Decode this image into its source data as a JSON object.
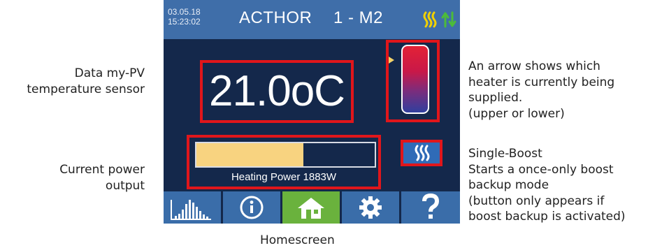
{
  "device": {
    "date": "03.05.18",
    "time": "15:23:02",
    "title": "ACTHOR",
    "id": "1 - M2"
  },
  "temperature": {
    "value": "21.0",
    "unit": "oC"
  },
  "power": {
    "label": "Heating Power 1883W",
    "fill_fraction": 0.6
  },
  "nav": [
    {
      "icon": "bar-chart-icon",
      "active": false
    },
    {
      "icon": "info-icon",
      "active": false
    },
    {
      "icon": "home-icon",
      "active": true
    },
    {
      "icon": "gear-icon",
      "active": false
    },
    {
      "icon": "help-icon",
      "active": false
    }
  ],
  "annotations": {
    "sensor": [
      "Data my-PV",
      "temperature sensor"
    ],
    "power_output": [
      "Current power",
      "output"
    ],
    "heater_arrow": [
      "An arrow shows which",
      "heater is currently being",
      "supplied.",
      "(upper or lower)"
    ],
    "boost": [
      "Single-Boost",
      "Starts a once-only boost",
      "backup mode",
      "(button only appears if",
      "boost backup is activated)"
    ]
  },
  "caption": "Homescreen",
  "colors": {
    "screen_bg": "#14284b",
    "topbar": "#3f6ea9",
    "nav_button": "#3a6da9",
    "nav_active": "#6ab23d",
    "highlight": "#e0161b",
    "power_fill": "#f8d380",
    "heat_icon": "#f0d000",
    "flow_icon": "#4cbb3a"
  }
}
